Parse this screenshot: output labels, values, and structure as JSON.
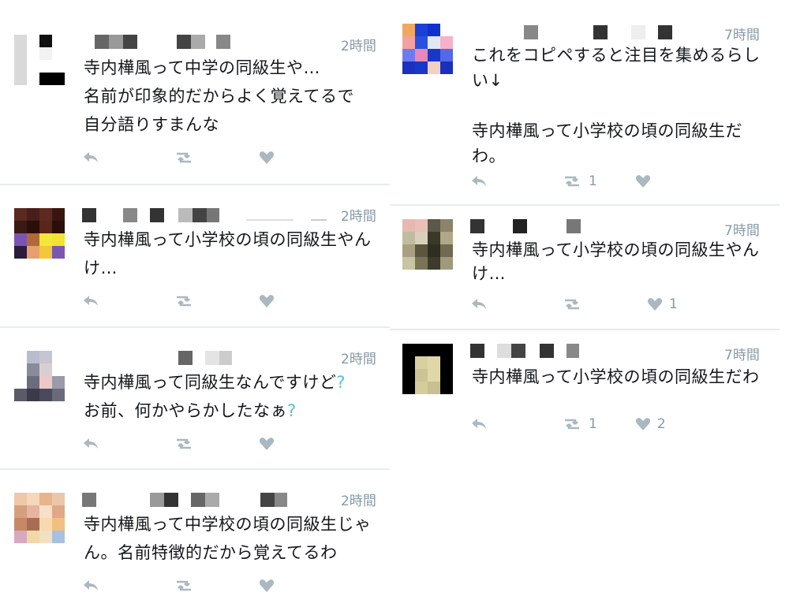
{
  "left_tweets": [
    {
      "time": "2時間",
      "text": "寺内樺風って中学の同級生や…\n名前が印象的だからよく覚えてるで\n自分語りすまんな",
      "retweet_count": "",
      "like_count": ""
    },
    {
      "time": "2時間",
      "text": "寺内樺風って小学校の頃の同級生やん\nけ…",
      "retweet_count": "",
      "like_count": ""
    },
    {
      "time": "2時間",
      "text_line1": "寺内樺風って同級生なんですけど",
      "text_line2": "お前、何かやらかしたなぁ",
      "qmark": "?",
      "retweet_count": "",
      "like_count": ""
    },
    {
      "time": "2時間",
      "text": "寺内樺風って中学校の頃の同級生じゃ\nん。名前特徴的だから覚えてるわ",
      "retweet_count": "",
      "like_count": ""
    }
  ],
  "right_tweets": [
    {
      "time": "7時間",
      "text": "これをコピペすると注目を集めるらし\nい↓\n\n寺内樺風って小学校の頃の同級生だ\nわ。",
      "retweet_count": "1",
      "like_count": ""
    },
    {
      "time": "7時間",
      "text": "寺内樺風って小学校の頃の同級生やん\nけ…",
      "retweet_count": "",
      "like_count": "1"
    },
    {
      "time": "7時間",
      "text": "寺内樺風って小学校の頃の同級生だわ",
      "retweet_count": "1",
      "like_count": "2"
    }
  ],
  "icons": {
    "reply": "reply-icon",
    "retweet": "retweet-icon",
    "like": "heart-icon"
  },
  "colors": {
    "icon_gray": "#aab8c2",
    "time_gray": "#8899a6",
    "divider": "#e6ecf0",
    "qmark": "#5bbfd6"
  }
}
